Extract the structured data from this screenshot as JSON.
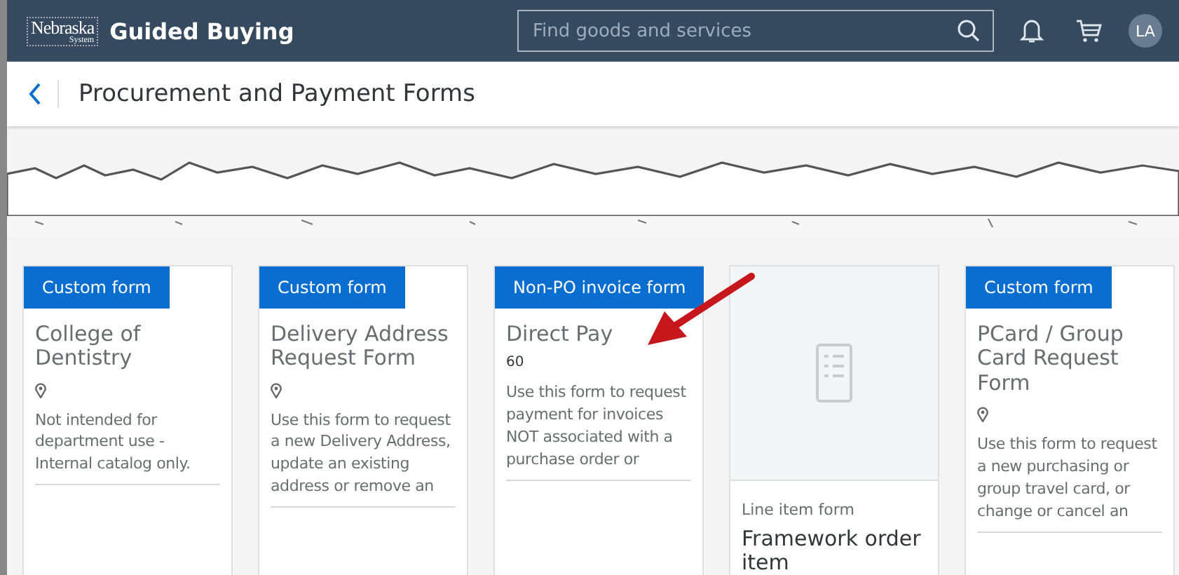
{
  "top_bar": {
    "logo": {
      "name": "Nebraska",
      "sub": "System"
    },
    "app_title": "Guided Buying",
    "search": {
      "placeholder": "Find goods and services"
    },
    "avatar": "LA"
  },
  "header": {
    "title": "Procurement and Payment Forms"
  },
  "cards": [
    {
      "kind": "badge",
      "badge": "Custom form",
      "title": "College of Dentistry",
      "description": "Not intended for department use - Internal catalog only."
    },
    {
      "kind": "badge",
      "badge": "Custom form",
      "title": "Delivery Address Request Form",
      "description": "Use this form to request a new Delivery Address, update an existing address or remove an"
    },
    {
      "kind": "badge",
      "badge": "Non-PO invoice form",
      "title": "Direct Pay",
      "meta": "60",
      "description": "Use this form to request payment for invoices NOT associated with a purchase order or"
    },
    {
      "kind": "image",
      "type_label": "Line item form",
      "title": "Framework order item"
    },
    {
      "kind": "badge",
      "badge": "Custom form",
      "title": "PCard / Group Card Request Form",
      "description": "Use this form to request a new purchasing or group travel card, or change or cancel an"
    }
  ]
}
